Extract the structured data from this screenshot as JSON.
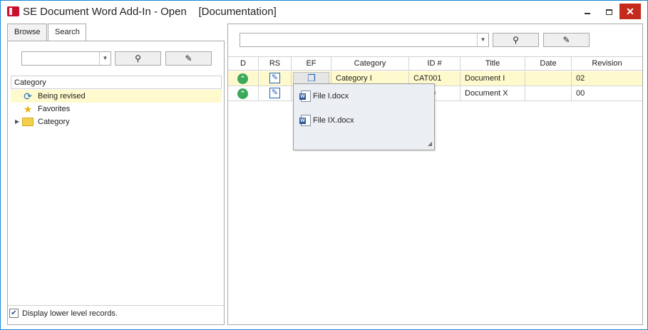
{
  "window": {
    "app_icon": "se-app-icon",
    "title": "SE Document Word Add-In - Open    [Documentation]",
    "minimize_label": "",
    "close_label": "✕"
  },
  "left": {
    "tabs": [
      {
        "label": "Browse",
        "active": true
      },
      {
        "label": "Search",
        "active": false
      }
    ],
    "search_value": "",
    "search_button_icon": "magnifier-icon",
    "clear_button_icon": "broom-icon",
    "tree_header": "Category",
    "tree": [
      {
        "label": "Being revised",
        "icon": "refresh-icon",
        "selected": true
      },
      {
        "label": "Favorites",
        "icon": "star-icon",
        "selected": false
      },
      {
        "label": "Category",
        "icon": "folder-icon",
        "selected": false,
        "expandable": true
      }
    ],
    "checkbox_label": "Display lower level records.",
    "checkbox_checked": true
  },
  "right": {
    "search_value": "",
    "columns": [
      "D",
      "RS",
      "EF",
      "Category",
      "ID #",
      "Title",
      "Date",
      "Revision"
    ],
    "rows": [
      {
        "category": "Category I",
        "id": "CAT001",
        "title": "Document I",
        "date": "",
        "revision": "02",
        "selected": true
      },
      {
        "category": "",
        "id": "0",
        "title": "Document X",
        "date": "",
        "revision": "00",
        "selected": false
      }
    ],
    "popup_files": [
      {
        "label": "File I.docx",
        "icon": "word-document-icon"
      },
      {
        "label": "File IX.docx",
        "icon": "word-document-icon"
      }
    ]
  },
  "colors": {
    "selection": "#fffacd",
    "accent": "#1a8ad4",
    "status_ok": "#3ca85a",
    "close_button": "#c42b1c"
  }
}
